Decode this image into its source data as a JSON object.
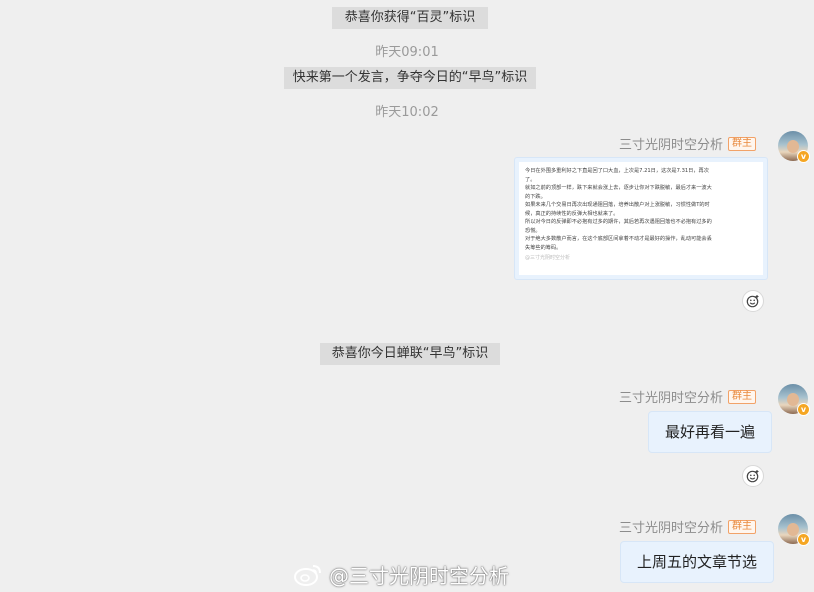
{
  "colors": {
    "background": "#efefef",
    "notice_bg": "#dcdcdc",
    "bubble_bg": "#e8f2fd",
    "badge_color": "#e8893d",
    "timestamp_color": "#9a9a9a"
  },
  "notices": [
    {
      "text": "恭喜你获得“百灵”标识"
    },
    {
      "text": "快来第一个发言，争夺今日的“早鸟”标识"
    },
    {
      "text": "恭喜你今日蝉联“早鸟”标识"
    }
  ],
  "timestamps": [
    "昨天09:01",
    "昨天10:02"
  ],
  "messages": [
    {
      "sender": "三寸光阴时空分析",
      "badge": "群主",
      "type": "image",
      "image_text": [
        "今日在外围多重利好之下直是回了口大血，上次是7.21日，这次是7.31日，再次",
        "了。",
        "就如之前的顶部一样，跌下来就会涨上去，逐步让你对下跌脱敏，最后才来一波大",
        "的下跌。",
        "如果未来几个交易日再次出现通阻回落，培养出散户对上涨脱敏，习惯性做T的时",
        "候，真正的持续性的反弹大相也就来了。",
        "所以对今日的反弹即不必抱有过多的期许，其后若再次遇阻回落也不必抱有过多的",
        "恐慌。",
        "对于绝大多数散户而言，在这个底部区间拿着不动才是最好的操作，乱动可能会丢",
        "失筹些的筹码。"
      ],
      "image_watermark": "@三寸光阴时空分析"
    },
    {
      "sender": "三寸光阴时空分析",
      "badge": "群主",
      "type": "text",
      "text": "最好再看一遍"
    },
    {
      "sender": "三寸光阴时空分析",
      "badge": "群主",
      "type": "text",
      "text": "上周五的文章节选"
    }
  ],
  "watermark": {
    "text": "@三寸光阴时空分析",
    "icon": "weibo-logo-icon"
  },
  "icons": {
    "emoji_react": "smile-plus-icon",
    "avatar_badge": "verified-v-icon"
  }
}
